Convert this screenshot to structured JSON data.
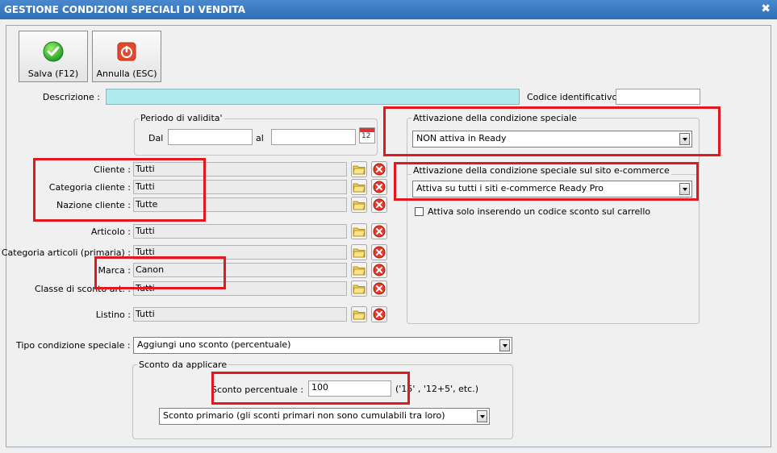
{
  "window": {
    "title": "GESTIONE CONDIZIONI SPECIALI DI VENDITA",
    "close_glyph": "✖"
  },
  "toolbar": {
    "save_label": "Salva (F12)",
    "cancel_label": "Annulla (ESC)"
  },
  "descrizione": {
    "label": "Descrizione :",
    "value": ""
  },
  "codice": {
    "label": "Codice identificativo :",
    "value": ""
  },
  "periodo": {
    "title": "Periodo di validita'",
    "dal_label": "Dal",
    "dal_value": "",
    "al_label": "al",
    "al_value": "",
    "calendar_text": "12"
  },
  "filters": [
    {
      "label": "Cliente :",
      "value": "Tutti"
    },
    {
      "label": "Categoria cliente :",
      "value": "Tutti"
    },
    {
      "label": "Nazione cliente :",
      "value": "Tutte"
    },
    {
      "label": "Articolo :",
      "value": "Tutti"
    },
    {
      "label": "Categoria articoli (primaria) :",
      "value": "Tutti"
    },
    {
      "label": "Marca :",
      "value": "Canon"
    },
    {
      "label": "Classe di sconto art. :",
      "value": "Tutti"
    },
    {
      "label": "Listino :",
      "value": "Tutti"
    }
  ],
  "attivazione": {
    "title": "Attivazione della condizione speciale",
    "value": "NON attiva in Ready"
  },
  "attivazione_ecommerce": {
    "title": "Attivazione della condizione speciale sul sito e-commerce",
    "value": "Attiva su tutti i siti e-commerce Ready Pro"
  },
  "coupon_checkbox": {
    "label": "Attiva solo inserendo un codice sconto sul carrello",
    "checked": false
  },
  "tipo": {
    "label": "Tipo condizione speciale :",
    "value": "Aggiungi uno sconto (percentuale)"
  },
  "sconto": {
    "title": "Sconto da applicare",
    "label": "Sconto percentuale :",
    "value": "100",
    "hint": "('15' ,  '12+5', etc.)",
    "type_value": "Sconto primario (gli sconti primari non sono cumulabili tra loro)"
  },
  "colors": {
    "titlebar": "#2f6db5",
    "highlight": "#e0191f",
    "description_field": "#b0ecef"
  }
}
